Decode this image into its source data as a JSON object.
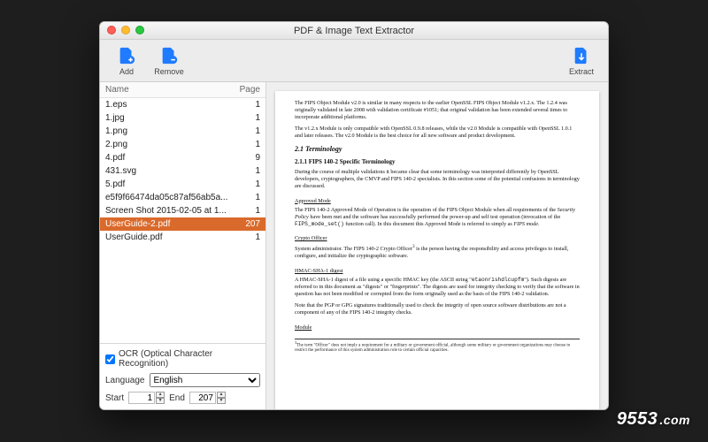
{
  "window": {
    "title": "PDF & Image Text Extractor"
  },
  "toolbar": {
    "add": "Add",
    "remove": "Remove",
    "extract": "Extract"
  },
  "list": {
    "header_name": "Name",
    "header_page": "Page",
    "rows": [
      {
        "name": "1.eps",
        "page": "1",
        "selected": false
      },
      {
        "name": "1.jpg",
        "page": "1",
        "selected": false
      },
      {
        "name": "1.png",
        "page": "1",
        "selected": false
      },
      {
        "name": "2.png",
        "page": "1",
        "selected": false
      },
      {
        "name": "4.pdf",
        "page": "9",
        "selected": false
      },
      {
        "name": "431.svg",
        "page": "1",
        "selected": false
      },
      {
        "name": "5.pdf",
        "page": "1",
        "selected": false
      },
      {
        "name": "e5f9f66474da05c87af56ab5a...",
        "page": "1",
        "selected": false
      },
      {
        "name": "Screen Shot 2015-02-05 at 1...",
        "page": "1",
        "selected": false
      },
      {
        "name": "UserGuide-2.pdf",
        "page": "207",
        "selected": true
      },
      {
        "name": "UserGuide.pdf",
        "page": "1",
        "selected": false
      }
    ]
  },
  "controls": {
    "ocr_label": "OCR (Optical Character Recognition)",
    "ocr_checked": true,
    "language_label": "Language",
    "language_value": "English",
    "start_label": "Start",
    "start_value": "1",
    "end_label": "End",
    "end_value": "207"
  },
  "doc": {
    "p1": "The FIPS Object Module v2.0 is similar in many respects to the earlier OpenSSL FIPS Object Module v1.2.x. The 1.2.4 was originally validated in late 2008 with validation certificate #1051; that original validation has been extended several times to incorporate additional platforms.",
    "p2": "The v1.2.x Module is only compatible with OpenSSL 0.9.8 releases, while the v2.0 Module is compatible with OpenSSL 1.0.1 and later releases. The v2.0 Module is the best choice for all new software and product development.",
    "h21": "2.1  Terminology",
    "h211": "2.1.1  FIPS 140-2 Specific Terminology",
    "p3": "During the course of multiple validations it became clear that some terminology was interpreted differently by OpenSSL developers, cryptographers, the CMVP and FIPS 140-2 specialists.  In this section some of the potential confusions in terminology are discussed.",
    "u_approved": "Approved Mode",
    "p4a": "The FIPS 140-2 Approved Mode of Operation is the operation of the FIPS Object Module when all requirements of the ",
    "p4b": "Security Policy",
    "p4c": " have been met and the software has successfully performed the power-up and self test operation (invocation of the ",
    "p4d": "FIPS_mode_set()",
    "p4e": " function call).  In this document this Approved Mode is referred to simply as ",
    "p4f": "FIPS mode",
    "p4g": ".",
    "u_crypto": "Crypto Officer",
    "p5a": "System administrator.  The FIPS 140-2 Crypto Officer",
    "p5sup": "3",
    "p5b": " is the person having the responsibility and access privileges to install, configure, and initialize the cryptographic software.",
    "u_hmac": "HMAC-SHA-1 digest",
    "p6a": "A HMAC-SHA-1 digest of a file using a specific HMAC key (the ASCII string \"",
    "p6b": "etaonrishdlcupfm",
    "p6c": "\").  Such digests are referred to in this document as \"digests\" or \"fingerprints\".  The digests are used for integrity checking to verify that the software in question has not been modified or corrupted from the form originally used as the basis of the FIPS 140-2 validation.",
    "p7": "Note that the PGP or GPG signatures traditionally used to check the integrity of open source software distributions are not a component of any of the FIPS 140-2 integrity checks.",
    "u_module": "Module",
    "fn": "The term \"Officer\" does not imply a requirement for a military or government official, although some military or government organizations may choose to restrict the performance of this system administration role to certain official capacities."
  },
  "watermark": {
    "brand": "9553",
    "suffix": ".com"
  }
}
